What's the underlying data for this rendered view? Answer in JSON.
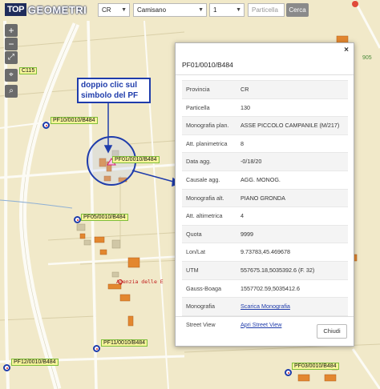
{
  "app": {
    "logo_top": "TOP",
    "logo_geo": "GEOMETRI"
  },
  "search": {
    "province": "CR",
    "municipality": "Camisano",
    "sheet": "1",
    "parcel_placeholder": "Particella",
    "search_button": "Cerca"
  },
  "map_controls": {
    "zoom_in": "+",
    "zoom_out": "−",
    "fullscreen": "⤢",
    "locate": "⌖",
    "search": "⌕"
  },
  "map_labels": {
    "c115": "C115",
    "pf10": "PF10/0010/B484",
    "pf01": "PF01/0010/B484",
    "pf05": "PF05/0010/B484",
    "pf11": "PF11/0010/B484",
    "pf12": "PF12/0010/B484",
    "pf03": "PF03/0010/B484",
    "annotation": "doppio clic sul simbolo del PF",
    "agenzia": "Agenzia delle E",
    "road_number": "905"
  },
  "modal": {
    "title": "PF01/0010/B484",
    "close": "×",
    "rows": [
      {
        "key": "Provincia",
        "value": "CR"
      },
      {
        "key": "Particella",
        "value": "130"
      },
      {
        "key": "Monografia plan.",
        "value": "ASSE PICCOLO CAMPANILE (M/217)"
      },
      {
        "key": "Att. planimetrica",
        "value": "8"
      },
      {
        "key": "Data agg.",
        "value": "-0/18/20"
      },
      {
        "key": "Causale agg.",
        "value": "AGG. MONOG."
      },
      {
        "key": "Monografia alt.",
        "value": "PIANO GRONDA"
      },
      {
        "key": "Att. altimetrica",
        "value": "4"
      },
      {
        "key": "Quota",
        "value": "9999"
      },
      {
        "key": "Lon/Lat",
        "value": "9.73783,45.469678"
      },
      {
        "key": "UTM",
        "value": "557675.18,5035392.6 (F. 32)"
      },
      {
        "key": "Gauss-Boaga",
        "value": "1557702.59,5035412.6"
      },
      {
        "key": "Monografia",
        "value": "Scarica Monografia"
      },
      {
        "key": "Street View",
        "value": "Apri Street View"
      }
    ],
    "close_button": "Chiudi"
  },
  "colors": {
    "map_background": "#f1e9c9",
    "road": "#fcfbf5",
    "building": "#e3872f",
    "annotation_blue": "#1f3cab",
    "label_yellow": "#f7f59a"
  }
}
